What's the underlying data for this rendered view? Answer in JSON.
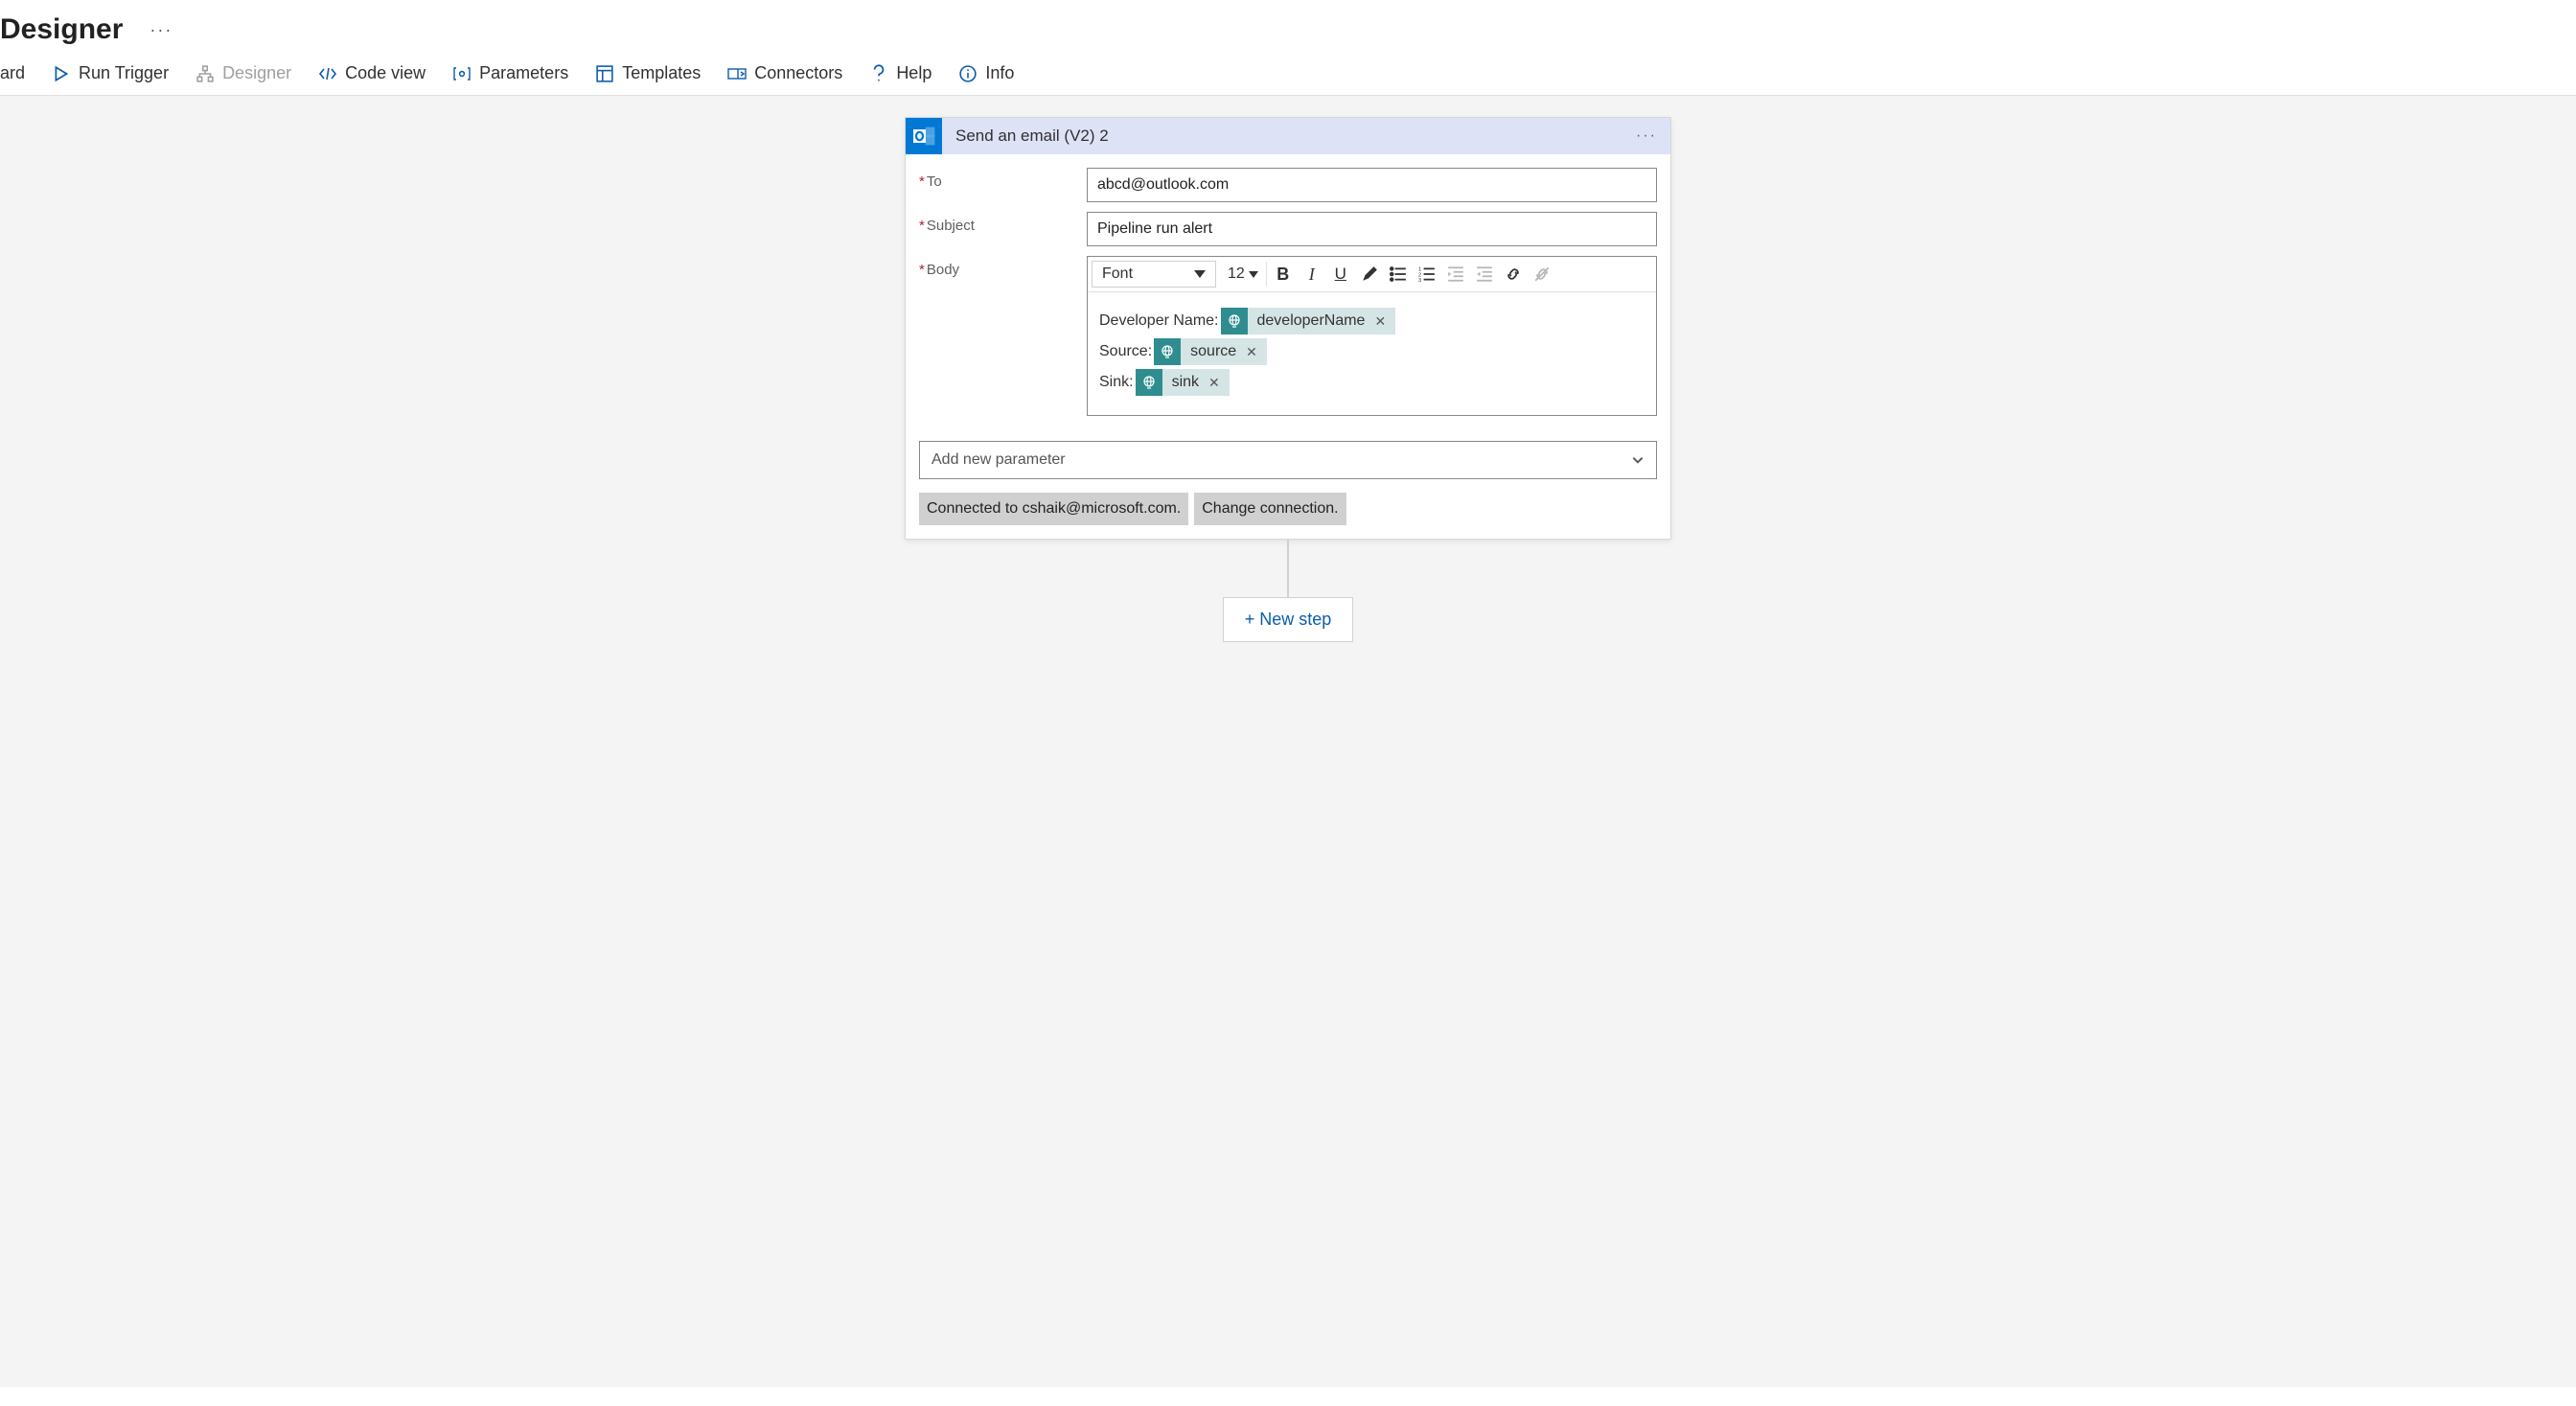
{
  "header": {
    "title": "Designer"
  },
  "cmdbar": {
    "ard": "ard",
    "run_trigger": "Run Trigger",
    "designer": "Designer",
    "code_view": "Code view",
    "parameters": "Parameters",
    "templates": "Templates",
    "connectors": "Connectors",
    "help": "Help",
    "info": "Info"
  },
  "card": {
    "title": "Send an email (V2) 2",
    "labels": {
      "to": "To",
      "subject": "Subject",
      "body": "Body"
    },
    "to_value": "abcd@outlook.com",
    "subject_value": "Pipeline run alert",
    "body": {
      "font_label": "Font",
      "font_size": "12",
      "lines": [
        {
          "prefix": "Developer Name:",
          "token": "developerName"
        },
        {
          "prefix": "Source:",
          "token": "source"
        },
        {
          "prefix": "Sink:",
          "token": "sink"
        }
      ]
    },
    "add_param_label": "Add new parameter",
    "conn_text": "Connected to cshaik@microsoft.com.",
    "conn_change": "Change connection."
  },
  "new_step_label": "+ New step"
}
